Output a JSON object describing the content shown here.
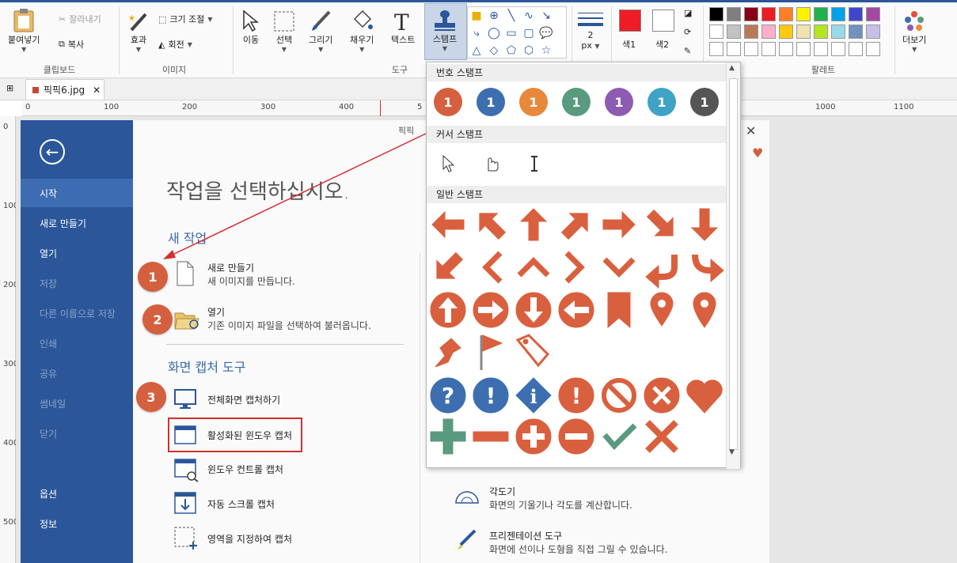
{
  "ribbon": {
    "clipboard": {
      "paste": "붙여넣기",
      "cut": "잘라내기",
      "copy": "복사",
      "label": "클립보드"
    },
    "image": {
      "effect": "효과",
      "resize": "크기 조절",
      "rotate": "회전",
      "label": "이미지"
    },
    "tools": {
      "move": "이동",
      "select": "선택",
      "draw": "그리기",
      "fill": "채우기",
      "text": "텍스트",
      "stamp": "스탬프",
      "label": "도구"
    },
    "line": {
      "width": "2",
      "unit": "px"
    },
    "colors": {
      "color1": "색1",
      "color2": "색2",
      "color1_value": "#ee1c24",
      "color2_value": "#ffffff"
    },
    "palette": {
      "label": "팔레트",
      "row1": [
        "#000000",
        "#7f7f7f",
        "#880015",
        "#ed1c24",
        "#ff7f27",
        "#fff200",
        "#22b14c",
        "#00a2e8",
        "#3f48cc",
        "#a349a4"
      ],
      "row2": [
        "#ffffff",
        "#c3c3c3",
        "#b97a57",
        "#ffaec9",
        "#ffc90e",
        "#efe4b0",
        "#b5e61d",
        "#99d9ea",
        "#7092be",
        "#c8bfe7"
      ]
    },
    "more": "더보기"
  },
  "tab": {
    "name": "픽픽6.jpg"
  },
  "ruler": {
    "h": [
      "0",
      "100",
      "200",
      "300",
      "400",
      "5",
      "1000",
      "1100"
    ],
    "v": [
      "0",
      "100",
      "200",
      "300",
      "400",
      "500"
    ]
  },
  "sidebar": {
    "items": [
      {
        "label": "시작"
      },
      {
        "label": "새로 만들기"
      },
      {
        "label": "열기"
      },
      {
        "label": "저장"
      },
      {
        "label": "다른 이름으로 저장"
      },
      {
        "label": "인쇄"
      },
      {
        "label": "공유"
      },
      {
        "label": "썸네일"
      },
      {
        "label": "닫기"
      },
      {
        "label": "옵션"
      },
      {
        "label": "정보"
      }
    ]
  },
  "main": {
    "title": "작업을 선택하십시오.",
    "new_section": "새 작업",
    "new_item": {
      "title": "새로 만들기",
      "desc": "새 이미지를 만듭니다."
    },
    "open_item": {
      "title": "열기",
      "desc": "기존 이미지 파일을 선택하여 불러옵니다."
    },
    "capture_section": "화면 캡처 도구",
    "capture_items": [
      "전체화면 캡처하기",
      "활성화된 윈도우 캡처",
      "윈도우 컨트롤 캡처",
      "자동 스크롤 캡처",
      "영역을 지정하여 캡처"
    ],
    "protractor": {
      "title": "각도기",
      "desc": "화면의 기울기나 각도를 계산합니다."
    },
    "presentation": {
      "title": "프리젠테이션 도구",
      "desc": "화면에 선이나 도형을 직접 그릴 수 있습니다."
    },
    "top_label": "픽픽",
    "badges": [
      "1",
      "2",
      "3"
    ]
  },
  "stamp_panel": {
    "number_header": "번호 스탬프",
    "cursor_header": "커서 스탬프",
    "general_header": "일반 스탬프",
    "number_colors": [
      "#d4603f",
      "#3d6fb0",
      "#e8883a",
      "#5a9a7f",
      "#8e5bb3",
      "#3ea3c4",
      "#555555"
    ],
    "number_text": "1"
  }
}
